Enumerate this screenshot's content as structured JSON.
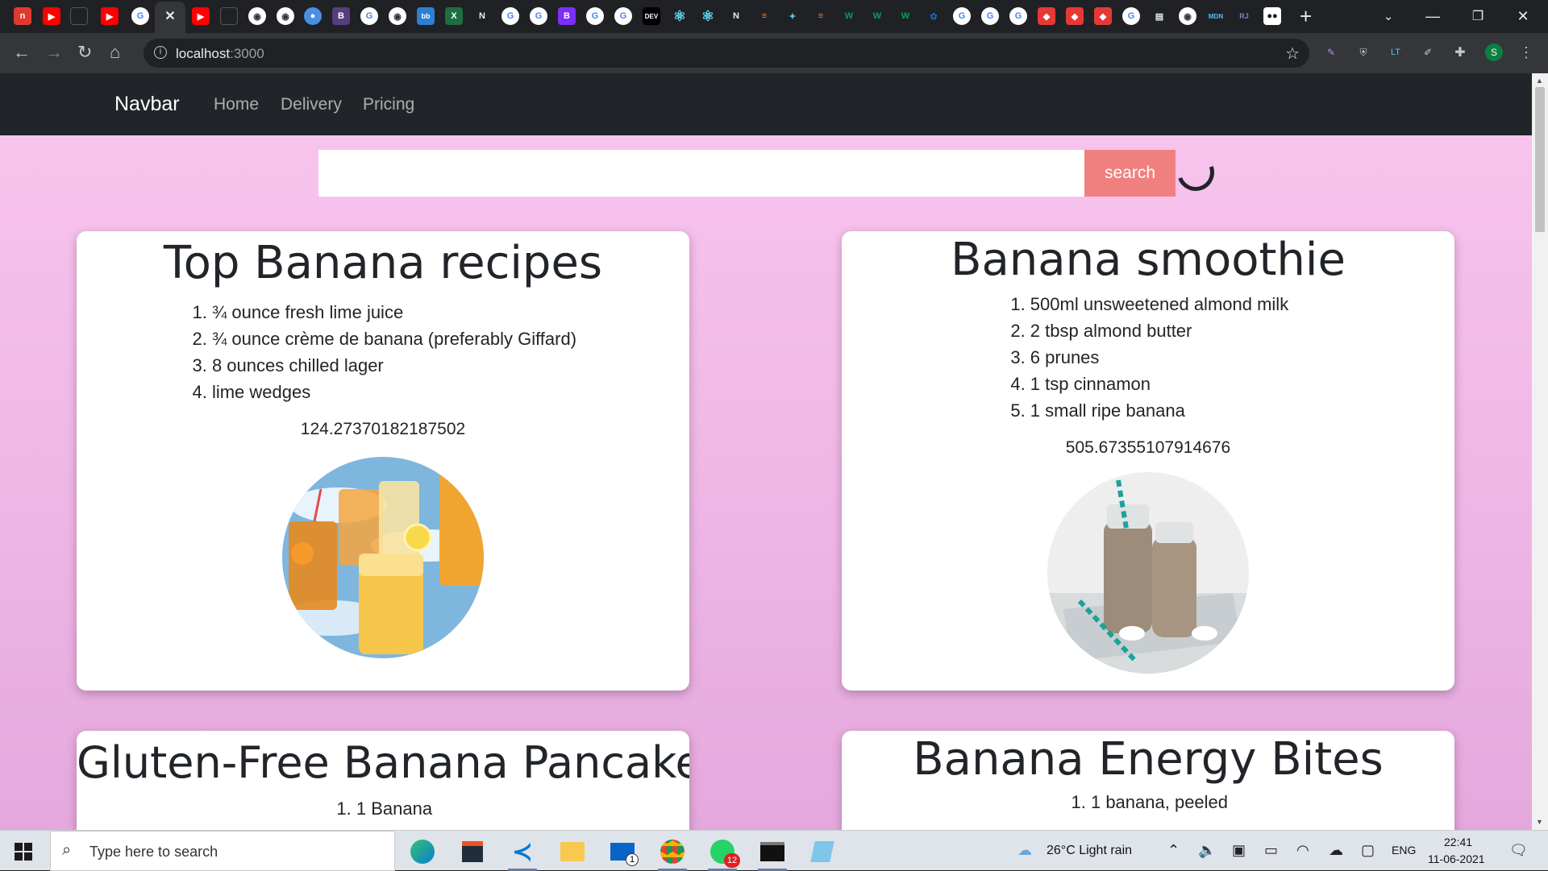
{
  "browser": {
    "url_host": "localhost",
    "url_port": ":3000",
    "profile_initial": "S"
  },
  "navbar": {
    "brand": "Navbar",
    "links": [
      "Home",
      "Delivery",
      "Pricing"
    ]
  },
  "search": {
    "value": "",
    "button_label": "search"
  },
  "recipes": [
    {
      "title": "Top Banana recipes",
      "ingredients": [
        "¾ ounce fresh lime juice",
        "¾ ounce crème de banana (preferably Giffard)",
        "8 ounces chilled lager",
        "lime wedges"
      ],
      "number": "124.27370182187502"
    },
    {
      "title": "Banana smoothie",
      "ingredients": [
        "500ml unsweetened almond milk",
        "2 tbsp almond butter",
        "6 prunes",
        "1 tsp cinnamon",
        "1 small ripe banana"
      ],
      "number": "505.67355107914676"
    },
    {
      "title": "Gluten-Free Banana Pancakes",
      "ingredients": [
        "1 Banana"
      ]
    },
    {
      "title": "Banana Energy Bites",
      "ingredients": [
        "1 banana, peeled"
      ]
    }
  ],
  "taskbar": {
    "search_placeholder": "Type here to search",
    "weather": "26°C  Light rain",
    "language": "ENG",
    "time": "22:41",
    "date": "11-06-2021",
    "mail_badge": "1",
    "whatsapp_badge": "12"
  },
  "colors": {
    "search_button": "#f08080",
    "navbar_bg": "#212529",
    "page_gradient_top": "#f9c6ee",
    "page_gradient_bottom": "#e5a8dd"
  }
}
